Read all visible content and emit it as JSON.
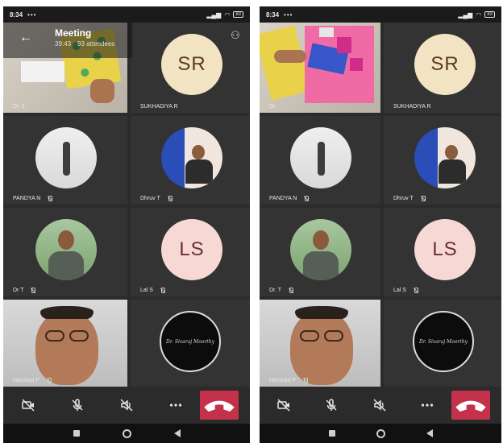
{
  "left": {
    "status": {
      "time": "8:34",
      "indicators": "•••",
      "battery": "83"
    },
    "header": {
      "title": "Meeting",
      "duration": "39:43",
      "attendees": "93 attendees"
    },
    "tiles": [
      {
        "name": "Dr. J"
      },
      {
        "name": "SUKHADIYA R",
        "initials": "SR"
      },
      {
        "name": "PANDYA N"
      },
      {
        "name": "Dhruv T"
      },
      {
        "name": "Dr T"
      },
      {
        "name": "Lal S",
        "initials": "LS"
      },
      {
        "name": "Harshad P"
      },
      {
        "name": "",
        "logo_text": "Dr. Sivaraj Moorthy"
      }
    ]
  },
  "right": {
    "status": {
      "time": "8:34",
      "indicators": "•••",
      "battery": "83"
    },
    "tiles": [
      {
        "name": "Dr."
      },
      {
        "name": "SUKHADIYA R",
        "initials": "SR"
      },
      {
        "name": "PANDYA N"
      },
      {
        "name": "Dhruv T"
      },
      {
        "name": "Dr. T"
      },
      {
        "name": "Lal S",
        "initials": "LS"
      },
      {
        "name": "Harshad P"
      },
      {
        "name": "",
        "logo_text": "Dr. Sivaraj Moorthy"
      }
    ]
  },
  "icons": {
    "camera_off": "video-off-icon",
    "mic_off": "mic-off-icon",
    "speaker_off": "speaker-off-icon",
    "more": "more-icon",
    "hangup": "hang-up-icon",
    "participants": "add-participant-icon"
  },
  "colors": {
    "hangup": "#c4314b",
    "tile": "#333333",
    "background": "#2b2b2b"
  }
}
